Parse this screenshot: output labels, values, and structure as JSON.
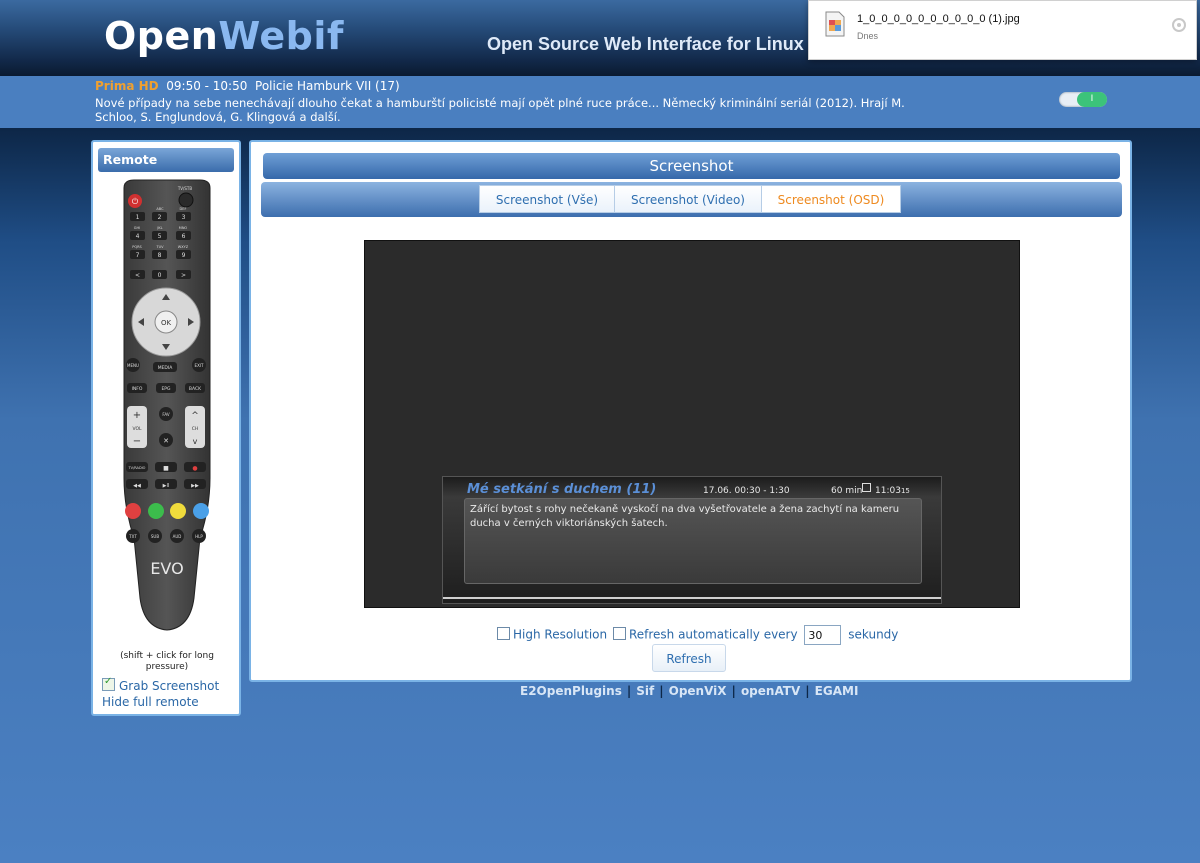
{
  "header": {
    "logo_open": "Open",
    "logo_webif": "Webif",
    "slogan": "Open Source Web Interface for Linux"
  },
  "download": {
    "file_name": "1_0_0_0_0_0_0_0_0_0_0 (1).jpg",
    "date_label": "Dnes",
    "icon": "image-file-icon"
  },
  "now_playing": {
    "channel": "Prima HD",
    "time": "09:50 - 10:50",
    "title": "Policie Hamburk VII (17)",
    "description": "Nové případy na sebe nenechávají dlouho čekat a hamburští policisté mají opět plné ruce práce... Německý kriminální seriál (2012). Hrají M. Schloo, S. Englundová, G. Klingová a další.",
    "toggle_label": "I"
  },
  "remote": {
    "title": "Remote",
    "hint": "(shift + click for long pressure)",
    "grab_label": "Grab Screenshot",
    "grab_checked": true,
    "hide_label": "Hide full remote",
    "brand": "EVO",
    "keys": {
      "power": "⏻",
      "tvstb": "TV/STB",
      "k1": "1",
      "k2": "2",
      "k3": "3",
      "k4": "4",
      "k5": "5",
      "k6": "6",
      "k7": "7",
      "k8": "8",
      "k9": "9",
      "k0": "0",
      "abc": "ABC",
      "def": "DEF",
      "ghi": "GHI",
      "jkl": "JKL",
      "mno": "MNO",
      "pqrs": "PQRS",
      "tuv": "TUV",
      "wxyz": "WXYZ",
      "prev": "<",
      "next": ">",
      "ok": "OK",
      "menu": "MENU",
      "media": "MEDIA",
      "exit": "EXIT",
      "info": "INFO",
      "epg": "EPG",
      "back": "BACK",
      "vol": "VOL",
      "ch": "CH",
      "fav": "FAV",
      "plus": "+",
      "minus": "−",
      "mute": "✕",
      "up": "^",
      "down": "v",
      "tvradio": "TV/RADIO",
      "stop": "■",
      "rec": "●",
      "rew": "◀◀",
      "playpause": "▶II",
      "ffw": "▶▶",
      "txt": "TXT",
      "sub": "SUB",
      "aud": "AUD",
      "hlp": "HLP"
    },
    "colors": {
      "red": "#e04040",
      "green": "#3cbc4c",
      "yellow": "#f0dc3c",
      "blue": "#4aa0e8"
    }
  },
  "main": {
    "title": "Screenshot",
    "tabs": [
      {
        "label": "Screenshot (Vše)",
        "active": false
      },
      {
        "label": "Screenshot (Video)",
        "active": false
      },
      {
        "label": "Screenshot (OSD)",
        "active": true
      }
    ],
    "osd": {
      "title": "Mé setkání s duchem (11)",
      "time": "17.06. 00:30 - 1:30",
      "duration": "60 min",
      "clock": "11:03",
      "clock_seconds": "15",
      "description": "Zářící bytost s rohy nečekaně vyskočí na dva vyšetřovatele a žena zachytí na kameru ducha v černých viktoriánských šatech."
    },
    "high_res_label": "High Resolution",
    "high_res_checked": false,
    "auto_refresh_label": "Refresh automatically every",
    "auto_refresh_checked": false,
    "interval_value": "30",
    "seconds_label": "sekundy",
    "refresh_button": "Refresh"
  },
  "footer": {
    "links": [
      "E2OpenPlugins",
      "Sif",
      "OpenViX",
      "openATV",
      "EGAMI"
    ]
  },
  "colors": {
    "accent_orange": "#ee8a20",
    "link_blue": "#2a67a6",
    "panel_border": "#7ab3e6"
  }
}
